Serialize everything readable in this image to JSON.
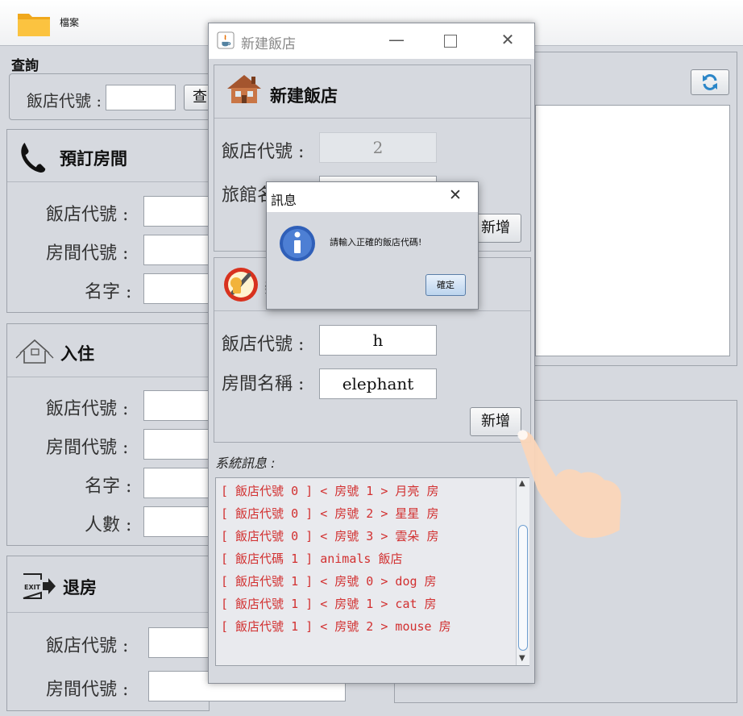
{
  "menu": {
    "file_label": "檔案"
  },
  "query": {
    "title": "查詢",
    "hotel_code_label": "飯店代號 :",
    "hotel_code_value": "",
    "button_label": "查"
  },
  "reserve": {
    "title": "預訂房間",
    "hotel_code_label": "飯店代號 :",
    "room_code_label": "房間代號 :",
    "name_label": "名字 :"
  },
  "checkin": {
    "title": "入住",
    "hotel_code_label": "飯店代號 :",
    "room_code_label": "房間代號 :",
    "name_label": "名字 :",
    "people_label": "人數 :"
  },
  "checkout": {
    "title": "退房",
    "hotel_code_label": "飯店代號 :",
    "room_code_label": "房間代號 :"
  },
  "dialog": {
    "title": "新建飯店",
    "new_hotel": {
      "header": "新建飯店",
      "hotel_code_label": "飯店代號 :",
      "hotel_code_value": "2",
      "hotel_name_label": "旅館名",
      "add_button": "新增"
    },
    "new_room": {
      "header": "新",
      "hotel_code_label": "飯店代號 :",
      "hotel_code_value": "h",
      "room_name_label": "房間名稱 :",
      "room_name_value": "elephant",
      "add_button": "新增"
    },
    "log": {
      "label": "系統訊息 :",
      "lines": [
        "[ 飯店代號 0 ] < 房號 1 > 月亮 房",
        "[ 飯店代號 0 ] < 房號 2 > 星星 房",
        "[ 飯店代號 0 ] < 房號 3 > 雲朵 房",
        "[ 飯店代碼 1 ] animals 飯店",
        "[ 飯店代號 1 ] < 房號 0 > dog 房",
        "[ 飯店代號 1 ] < 房號 1 > cat 房",
        "[ 飯店代號 1 ] < 房號 2 > mouse 房"
      ]
    }
  },
  "message": {
    "title": "訊息",
    "text": "請輸入正確的飯店代碼!",
    "ok_button": "確定"
  },
  "colors": {
    "log_text": "#d23030",
    "info_icon": "#2f5fb8",
    "background": "#d6d9df"
  }
}
